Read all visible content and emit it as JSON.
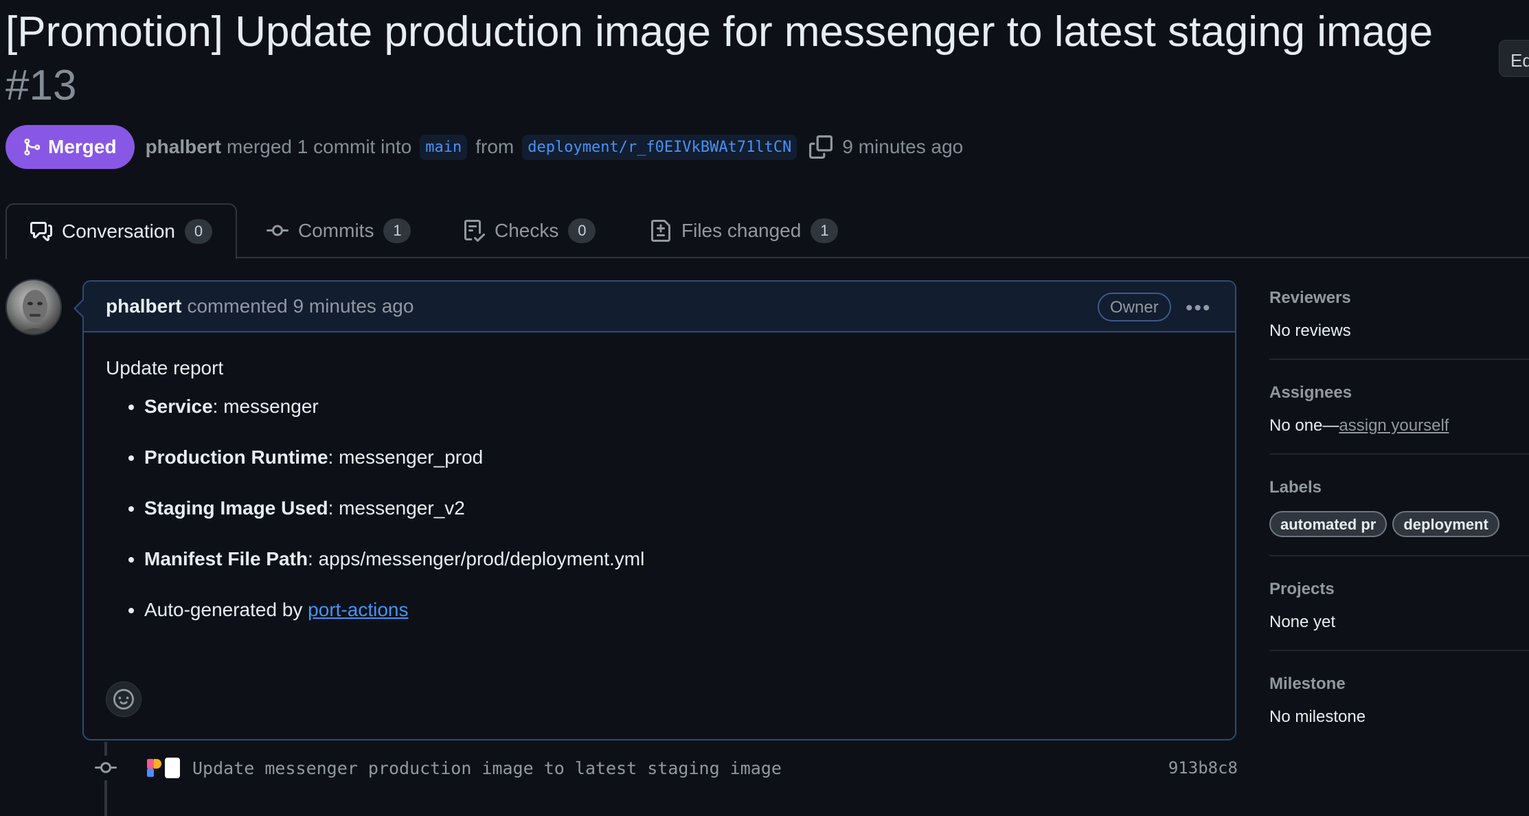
{
  "pr": {
    "title": "[Promotion] Update production image for messenger to latest staging image",
    "number": "#13",
    "edit_label": "Ed",
    "status": "Merged",
    "author": "phalbert",
    "merge_text": "merged 1 commit into",
    "base_branch": "main",
    "from_text": "from",
    "head_branch": "deployment/r_f0EIVkBWAt71ltCN",
    "time": "9 minutes ago"
  },
  "tabs": [
    {
      "label": "Conversation",
      "count": "0",
      "icon": "comment-discussion-icon",
      "active": true
    },
    {
      "label": "Commits",
      "count": "1",
      "icon": "git-commit-icon"
    },
    {
      "label": "Checks",
      "count": "0",
      "icon": "checklist-icon"
    },
    {
      "label": "Files changed",
      "count": "1",
      "icon": "file-diff-icon"
    }
  ],
  "comment": {
    "author": "phalbert",
    "action": "commented 9 minutes ago",
    "badge": "Owner",
    "intro": "Update report",
    "items": [
      {
        "key": "Service",
        "value": ": messenger"
      },
      {
        "key": "Production Runtime",
        "value": ": messenger_prod"
      },
      {
        "key": "Staging Image Used",
        "value": ": messenger_v2"
      },
      {
        "key": "Manifest File Path",
        "value": ": apps/messenger/prod/deployment.yml"
      }
    ],
    "footer_text": "Auto-generated by ",
    "footer_link": "port-actions"
  },
  "commit": {
    "message": "Update messenger production image to latest staging image",
    "sha": "913b8c8"
  },
  "sidebar": {
    "reviewers": {
      "heading": "Reviewers",
      "value": "No reviews"
    },
    "assignees": {
      "heading": "Assignees",
      "value": "No one—",
      "link": "assign yourself"
    },
    "labels": {
      "heading": "Labels",
      "items": [
        "automated pr",
        "deployment"
      ]
    },
    "projects": {
      "heading": "Projects",
      "value": "None yet"
    },
    "milestone": {
      "heading": "Milestone",
      "value": "No milestone"
    }
  },
  "colors": {
    "merged": "#8957e5",
    "link": "#4493f8",
    "background": "#0d1117"
  }
}
